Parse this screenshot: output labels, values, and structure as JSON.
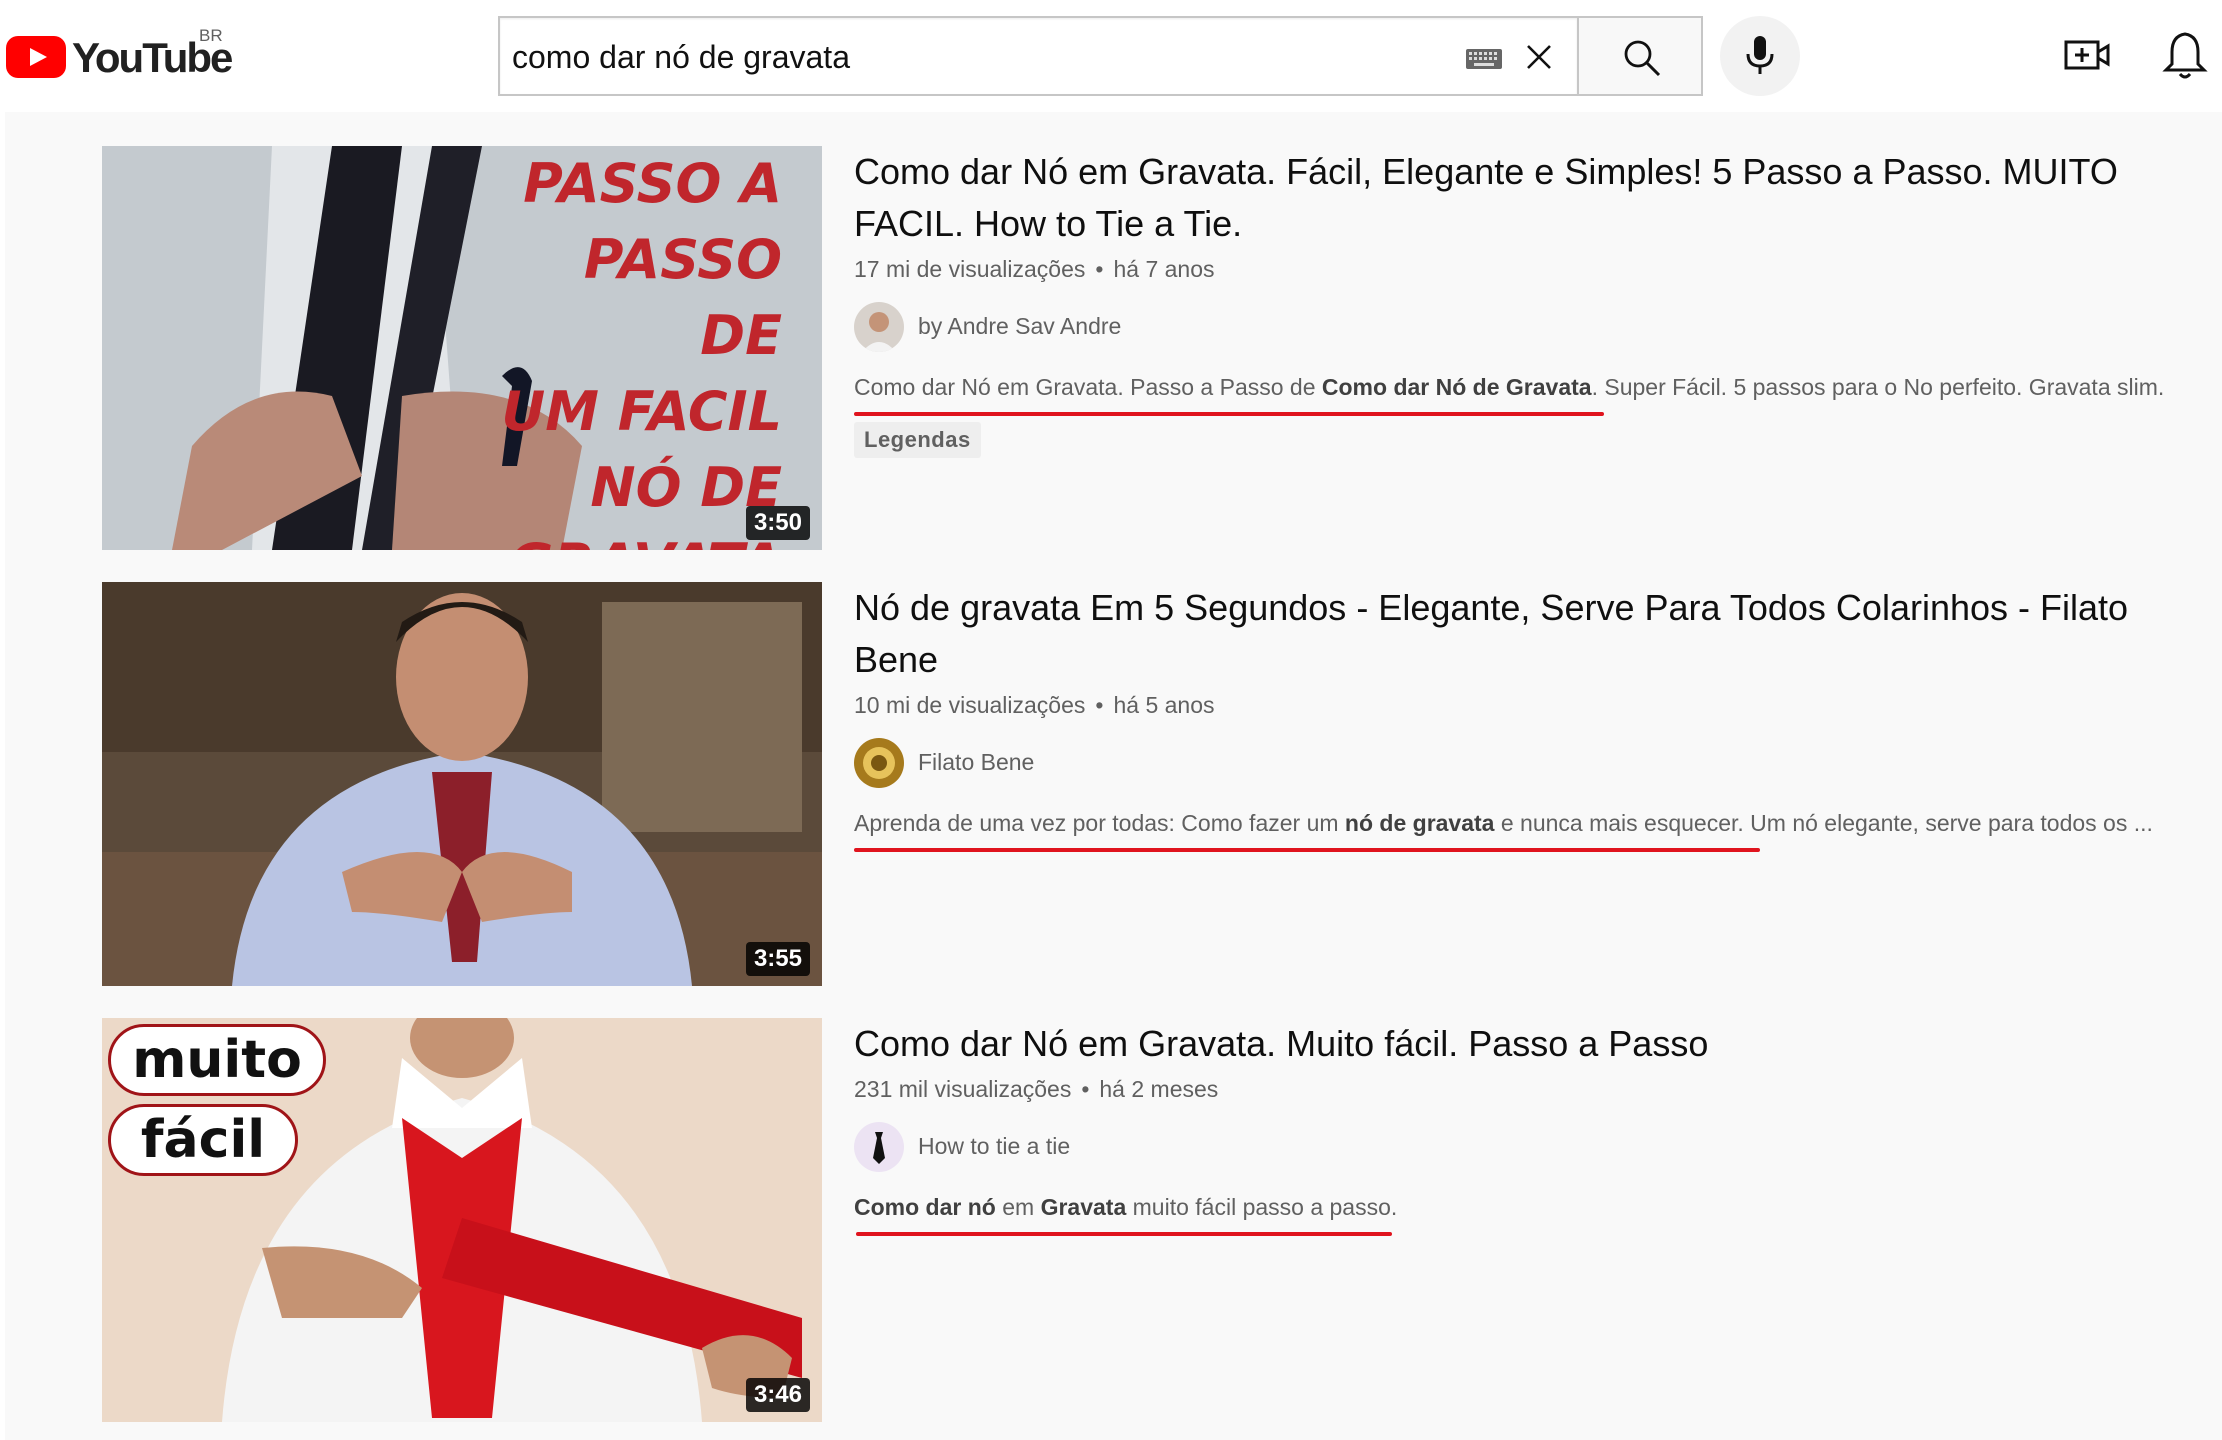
{
  "header": {
    "logo_text": "YouTube",
    "region": "BR",
    "search_value": "como dar nó de gravata",
    "icons": [
      "youtube-logo",
      "keyboard-icon",
      "close-icon",
      "search-icon",
      "mic-icon",
      "create-video-icon",
      "bell-icon"
    ]
  },
  "results": [
    {
      "title": "Como dar Nó em Gravata. Fácil, Elegante e Simples! 5 Passo a Passo. MUITO FACIL. How to Tie a Tie.",
      "views": "17 mi de visualizações",
      "age": "há 7 anos",
      "channel": "by Andre Sav Andre",
      "desc_parts": [
        "Como dar Nó em Gravata. Passo a Passo de ",
        "Como dar Nó de Gravata",
        ". Super Fácil. 5 passos para o No perfeito. Gravata slim."
      ],
      "badge": "Legendas",
      "duration": "3:50",
      "thumb_text": [
        "PASSO A",
        "PASSO DE",
        "UM FACIL",
        "NÓ DE",
        "GRAVATA"
      ]
    },
    {
      "title": "Nó de gravata Em 5 Segundos - Elegante, Serve Para Todos Colarinhos - Filato Bene",
      "views": "10 mi de visualizações",
      "age": "há 5 anos",
      "channel": "Filato Bene",
      "desc_parts": [
        "Aprenda de uma vez por todas: Como fazer um ",
        "nó de gravata",
        " e nunca mais esquecer. Um nó elegante, serve para todos os ..."
      ],
      "duration": "3:55"
    },
    {
      "title": "Como dar Nó em Gravata. Muito fácil. Passo a Passo",
      "views": "231 mil visualizações",
      "age": "há 2 meses",
      "channel": "How to tie a tie",
      "desc_parts": [
        "Como dar nó",
        " em ",
        "Gravata",
        " muito fácil passo a passo."
      ],
      "duration": "3:46",
      "thumb_text": [
        "muito",
        "fácil"
      ]
    }
  ],
  "colors": {
    "brand_red": "#ff0000",
    "annotation_red": "#e0141e",
    "page_bg": "#f9f9f9"
  }
}
